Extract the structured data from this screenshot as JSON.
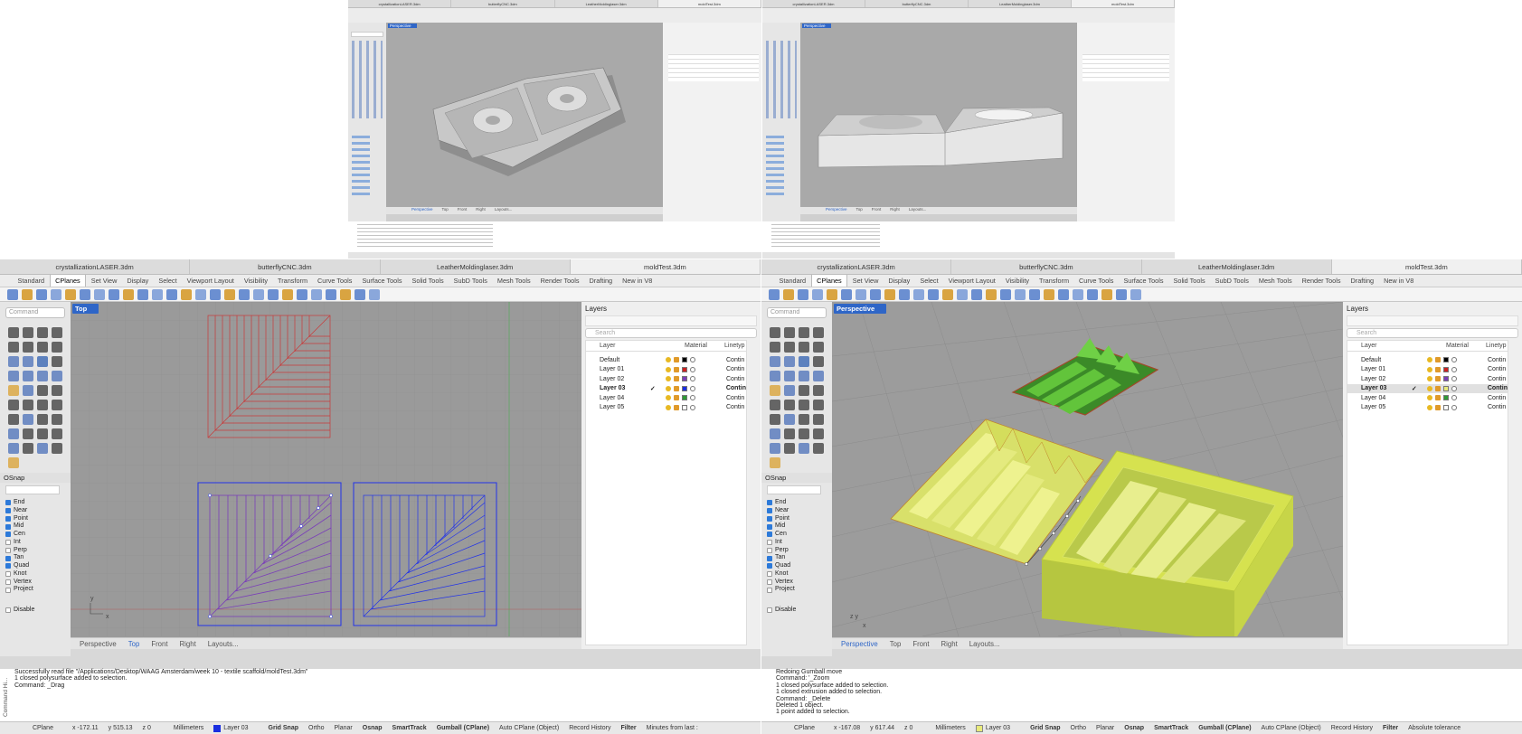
{
  "doc_tabs": [
    "crystallizationLASER.3dm",
    "butterflyCNC.3dm",
    "LeatherMoldinglaser.3dm",
    "moldTest.3dm"
  ],
  "tool_tabs": [
    "Standard",
    "CPlanes",
    "Set View",
    "Display",
    "Select",
    "Viewport Layout",
    "Visibility",
    "Transform",
    "Curve Tools",
    "Surface Tools",
    "Solid Tools",
    "SubD Tools",
    "Mesh Tools",
    "Render Tools",
    "Drafting",
    "New in V8"
  ],
  "command_placeholder": "Command",
  "osnap": {
    "title": "OSnap",
    "items": [
      {
        "label": "End",
        "on": true
      },
      {
        "label": "Near",
        "on": true
      },
      {
        "label": "Point",
        "on": true
      },
      {
        "label": "Mid",
        "on": true
      },
      {
        "label": "Cen",
        "on": true
      },
      {
        "label": "Int",
        "on": false
      },
      {
        "label": "Perp",
        "on": false
      },
      {
        "label": "Tan",
        "on": true
      },
      {
        "label": "Quad",
        "on": true
      },
      {
        "label": "Knot",
        "on": false
      },
      {
        "label": "Vertex",
        "on": false
      },
      {
        "label": "Project",
        "on": false
      }
    ],
    "disable": "Disable"
  },
  "layers_panel": {
    "title": "Layers",
    "search": "Search",
    "col_layer": "Layer",
    "col_material": "Material",
    "col_linetype": "Linetyp",
    "left_rows": [
      {
        "name": "Default",
        "color": "#000000",
        "lt": "Contin"
      },
      {
        "name": "Layer 01",
        "color": "#cc2222",
        "lt": "Contin"
      },
      {
        "name": "Layer 02",
        "color": "#7a3fb8",
        "lt": "Contin"
      },
      {
        "name": "Layer 03",
        "color": "#1a2ee0",
        "lt": "Contin",
        "current": true
      },
      {
        "name": "Layer 04",
        "color": "#2f9a35",
        "lt": "Contin"
      },
      {
        "name": "Layer 05",
        "color": "#ffffff",
        "lt": "Contin"
      }
    ],
    "right_rows": [
      {
        "name": "Default",
        "color": "#000000",
        "lt": "Contin"
      },
      {
        "name": "Layer 01",
        "color": "#cc2222",
        "lt": "Contin"
      },
      {
        "name": "Layer 02",
        "color": "#7a3fb8",
        "lt": "Contin"
      },
      {
        "name": "Layer 03",
        "color": "#e8ea7a",
        "lt": "Contin",
        "current": true
      },
      {
        "name": "Layer 04",
        "color": "#2f9a35",
        "lt": "Contin"
      },
      {
        "name": "Layer 05",
        "color": "#ffffff",
        "lt": "Contin"
      }
    ]
  },
  "left": {
    "viewport": "Top",
    "vp_tabs": [
      "Perspective",
      "Top",
      "Front",
      "Right",
      "Layouts..."
    ],
    "active_tab": "Top",
    "history": [
      "Successfully read file \"/Applications/Desktop/WAAG Amsterdam/week 10 - textile scaffold/moldTest.3dm\"",
      "1 closed polysurface added to selection.",
      "Command: _Drag"
    ],
    "status": {
      "cplane": "CPlane",
      "x": "x -172.11",
      "y": "y 515.13",
      "z": "z 0",
      "units": "Millimeters",
      "layer": "Layer 03",
      "layer_color": "#1a2ee0",
      "grid": "Grid Snap",
      "ortho": "Ortho",
      "planar": "Planar",
      "osnap": "Osnap",
      "smarttrack": "SmartTrack",
      "gumball": "Gumball (CPlane)",
      "auto": "Auto CPlane (Object)",
      "record": "Record History",
      "filter": "Filter",
      "extra": "Minutes from last :"
    }
  },
  "right": {
    "viewport": "Perspective",
    "vp_tabs": [
      "Perspective",
      "Top",
      "Front",
      "Right",
      "Layouts..."
    ],
    "active_tab": "Perspective",
    "history": [
      "Redoing Gumball move",
      "Command: '_Zoom",
      "1 closed polysurface added to selection.",
      "1 closed extrusion added to selection.",
      "Command: _Delete",
      "Deleted 1 object.",
      "1 point added to selection."
    ],
    "status": {
      "cplane": "CPlane",
      "x": "x -167.08",
      "y": "y 617.44",
      "z": "z 0",
      "units": "Millimeters",
      "layer": "Layer 03",
      "layer_color": "#e8ea7a",
      "grid": "Grid Snap",
      "ortho": "Ortho",
      "planar": "Planar",
      "osnap": "Osnap",
      "smarttrack": "SmartTrack",
      "gumball": "Gumball (CPlane)",
      "auto": "Auto CPlane (Object)",
      "record": "Record History",
      "filter": "Filter",
      "extra": "Absolute tolerance"
    }
  },
  "side_label": "Command Hi...",
  "top_mini": {
    "vp_label": "Perspective",
    "tabs": [
      "Perspective",
      "Top",
      "Front",
      "Right",
      "Layouts..."
    ]
  }
}
